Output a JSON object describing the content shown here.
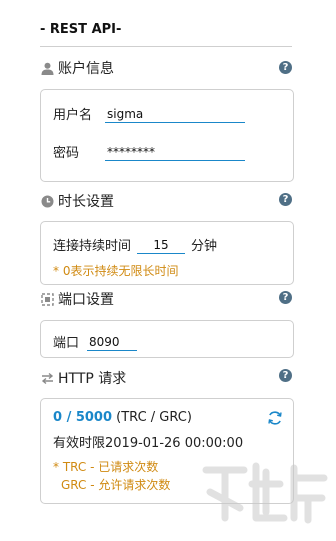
{
  "header": {
    "title": "- REST API-"
  },
  "account": {
    "title": "账户信息",
    "help": "?",
    "username_label": "用户名",
    "username_value": "sigma",
    "password_label": "密码",
    "password_value": "********"
  },
  "duration": {
    "title": "时长设置",
    "help": "?",
    "label": "连接持续时间",
    "value": "15",
    "unit": "分钟",
    "note": "* 0表示持续无限长时间"
  },
  "port": {
    "title": "端口设置",
    "help": "?",
    "label": "端口",
    "value": "8090"
  },
  "http": {
    "title": "HTTP 请求",
    "help": "?",
    "count": "0 / 5000",
    "count_suffix": "(TRC / GRC)",
    "valid_label": "有效时限",
    "valid_value": "2019-01-26 00:00:00",
    "note1": "* TRC - 已请求次数",
    "note2": "GRC - 允许请求次数"
  },
  "colors": {
    "accent": "#1a87c9",
    "note": "#d08a12",
    "border": "#cfcfcf",
    "help": "#4f6f86"
  }
}
